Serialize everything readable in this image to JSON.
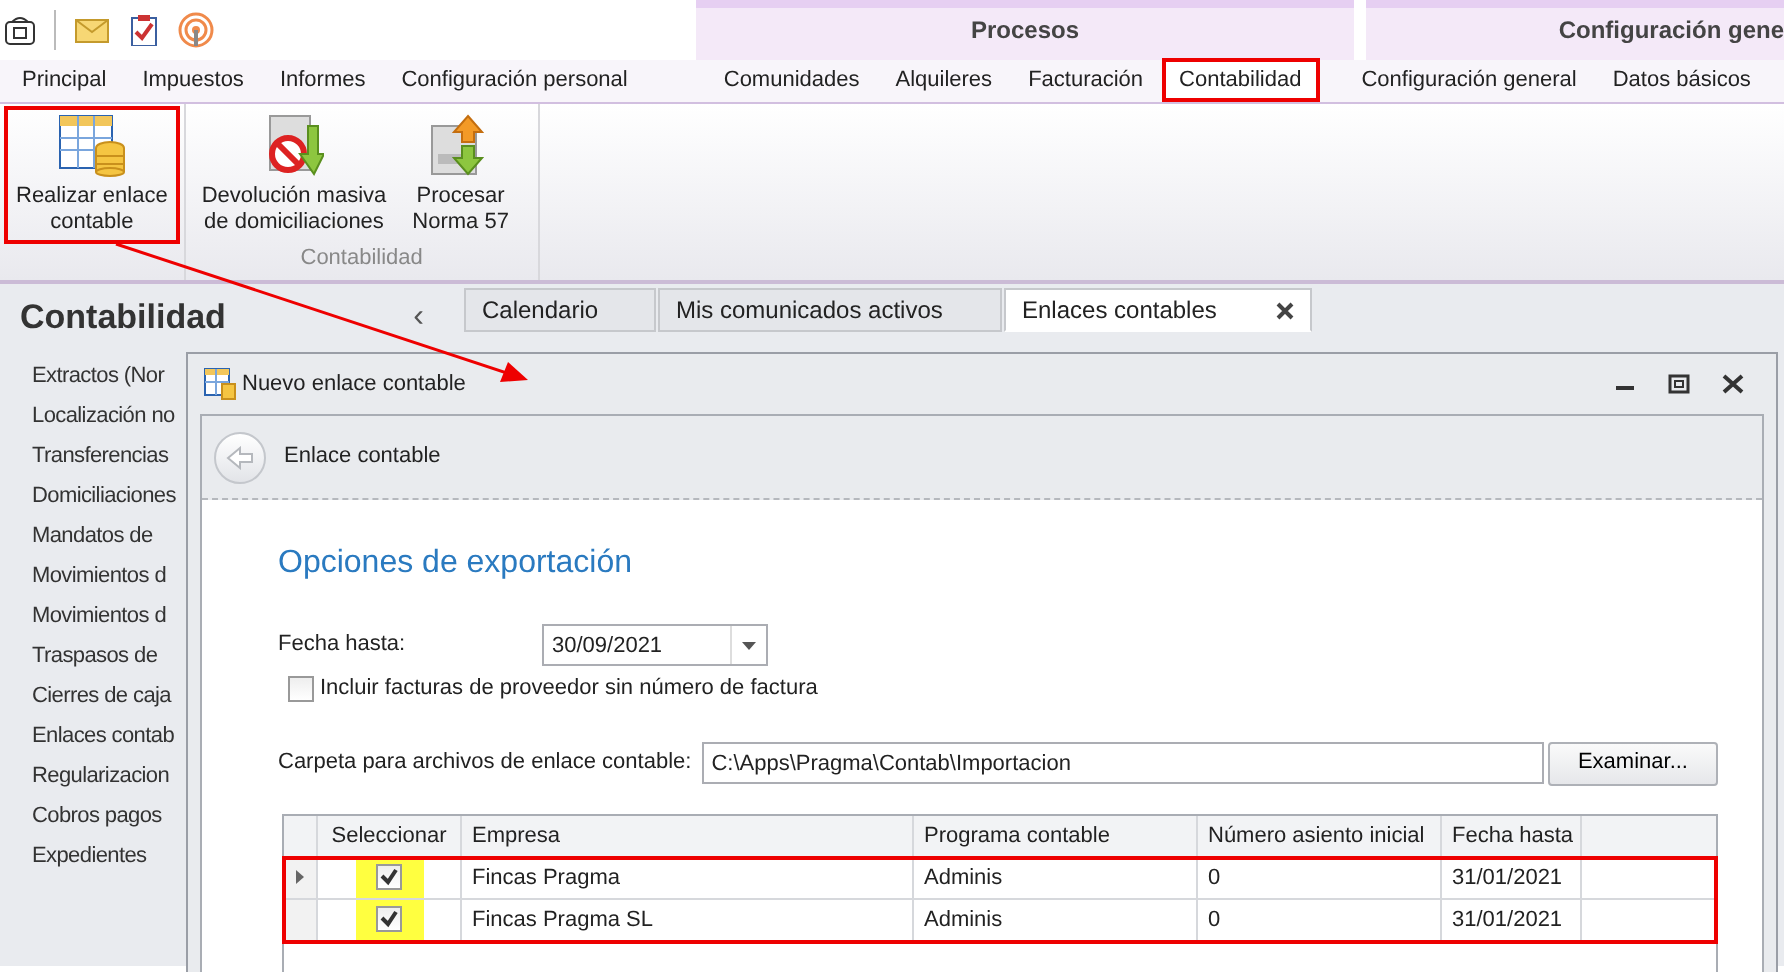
{
  "callout_arrow": true,
  "ribbon": {
    "group_headers": [
      {
        "label": "Procesos"
      },
      {
        "label": "Configuración gene"
      }
    ],
    "tabs": [
      {
        "label": "Principal",
        "selected": false,
        "highlighted": false
      },
      {
        "label": "Impuestos",
        "selected": false,
        "highlighted": false
      },
      {
        "label": "Informes",
        "selected": false,
        "highlighted": false
      },
      {
        "label": "Configuración personal",
        "selected": false,
        "highlighted": false
      },
      {
        "label": "Comunidades",
        "selected": false,
        "highlighted": false
      },
      {
        "label": "Alquileres",
        "selected": false,
        "highlighted": false
      },
      {
        "label": "Facturación",
        "selected": false,
        "highlighted": false
      },
      {
        "label": "Contabilidad",
        "selected": true,
        "highlighted": true
      },
      {
        "label": "Configuración general",
        "selected": false,
        "highlighted": false
      },
      {
        "label": "Datos básicos",
        "selected": false,
        "highlighted": false
      }
    ],
    "buttons": [
      {
        "kind": "ledger",
        "label": "Realizar enlace\ncontable",
        "highlighted": true
      },
      {
        "kind": "return",
        "label": "Devolución masiva\nde domiciliaciones",
        "highlighted": false
      },
      {
        "kind": "norma",
        "label": "Procesar\nNorma 57",
        "highlighted": false
      }
    ],
    "group_label": "Contabilidad"
  },
  "side_panel": {
    "title": "Contabilidad",
    "collapse": "‹",
    "items": [
      "Extractos (Nor",
      "Localización no",
      "Transferencias",
      "Domiciliaciones",
      "Mandatos de",
      "Movimientos d",
      "Movimientos d",
      "Traspasos de",
      "Cierres de caja",
      "Enlaces contab",
      "Regularizacion",
      "Cobros pagos",
      "Expedientes"
    ]
  },
  "doc_tabs": [
    {
      "label": "Calendario",
      "selected": false
    },
    {
      "label": "Mis comunicados activos",
      "selected": false
    },
    {
      "label": "Enlaces contables",
      "selected": true
    }
  ],
  "dialog": {
    "title": "Nuevo enlace contable",
    "header": "Enlace contable",
    "section_title": "Opciones de exportación",
    "date_label": "Fecha hasta:",
    "date_value": "30/09/2021",
    "include_checkbox": {
      "label": "Incluir facturas de proveedor sin número de factura",
      "checked": false
    },
    "folder_label": "Carpeta para archivos de enlace contable:",
    "folder_value": "C:\\Apps\\Pragma\\Contab\\Importacion",
    "browse_button": "Examinar...",
    "grid": {
      "rows_highlighted": true,
      "check_highlighted": true,
      "columns": [
        "Seleccionar",
        "Empresa",
        "Programa contable",
        "Número asiento inicial",
        "Fecha hasta"
      ],
      "rows": [
        {
          "current": true,
          "checked": true,
          "empresa": "Fincas Pragma",
          "programa": "Adminis",
          "asiento": "0",
          "fecha": "31/01/2021"
        },
        {
          "current": false,
          "checked": true,
          "empresa": "Fincas Pragma SL",
          "programa": "Adminis",
          "asiento": "0",
          "fecha": "31/01/2021"
        }
      ]
    }
  }
}
